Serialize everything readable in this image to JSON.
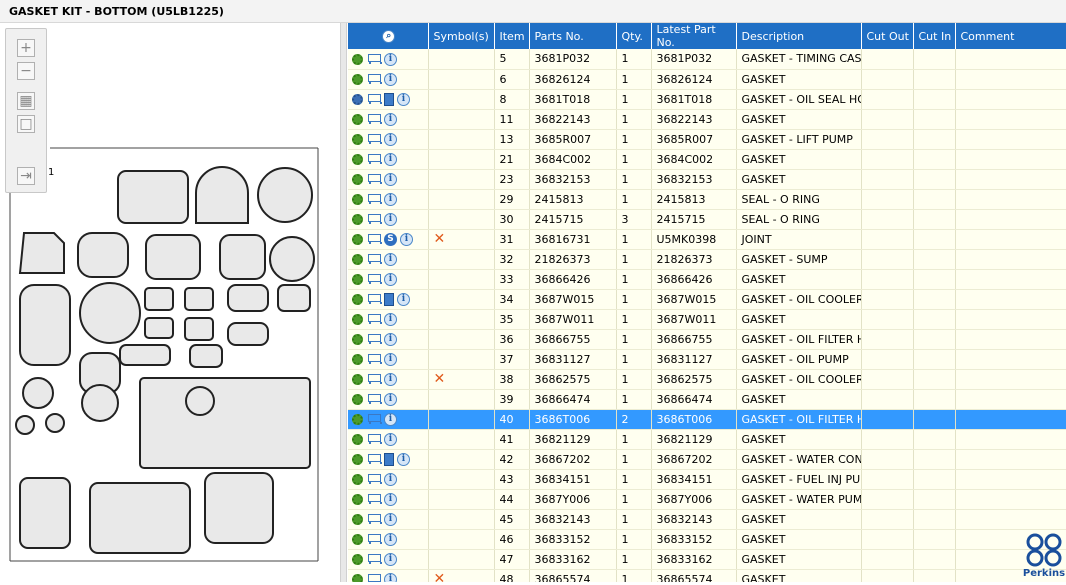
{
  "window": {
    "title": "GASKET KIT - BOTTOM (U5LB1225)"
  },
  "diagram": {
    "callout": "1"
  },
  "toolbox": {
    "zoom_in": "zoom-in-icon",
    "zoom_out": "zoom-out-icon",
    "fit": "fit-icon",
    "actual": "actual-size-icon",
    "export": "export-icon"
  },
  "columns": [
    "",
    "Symbol(s)",
    "Item",
    "Parts No.",
    "Qty.",
    "Latest Part No.",
    "Description",
    "Cut Out",
    "Cut In",
    "Comment"
  ],
  "rows": [
    {
      "icons": [
        "gear",
        "cart",
        "info"
      ],
      "symbol": "",
      "item": "5",
      "part": "3681P032",
      "qty": "1",
      "latest": "3681P032",
      "desc": "GASKET - TIMING CASE"
    },
    {
      "icons": [
        "gear",
        "cart",
        "info"
      ],
      "symbol": "",
      "item": "6",
      "part": "36826124",
      "qty": "1",
      "latest": "36826124",
      "desc": "GASKET"
    },
    {
      "icons": [
        "gear2",
        "cart",
        "book",
        "info"
      ],
      "symbol": "",
      "item": "8",
      "part": "3681T018",
      "qty": "1",
      "latest": "3681T018",
      "desc": "GASKET - OIL SEAL HOU"
    },
    {
      "icons": [
        "gear",
        "cart",
        "info"
      ],
      "symbol": "",
      "item": "11",
      "part": "36822143",
      "qty": "1",
      "latest": "36822143",
      "desc": "GASKET"
    },
    {
      "icons": [
        "gear",
        "cart",
        "info"
      ],
      "symbol": "",
      "item": "13",
      "part": "3685R007",
      "qty": "1",
      "latest": "3685R007",
      "desc": "GASKET - LIFT PUMP"
    },
    {
      "icons": [
        "gear",
        "cart",
        "info"
      ],
      "symbol": "",
      "item": "21",
      "part": "3684C002",
      "qty": "1",
      "latest": "3684C002",
      "desc": "GASKET"
    },
    {
      "icons": [
        "gear",
        "cart",
        "info"
      ],
      "symbol": "",
      "item": "23",
      "part": "36832153",
      "qty": "1",
      "latest": "36832153",
      "desc": "GASKET"
    },
    {
      "icons": [
        "gear",
        "cart",
        "info"
      ],
      "symbol": "",
      "item": "29",
      "part": "2415813",
      "qty": "1",
      "latest": "2415813",
      "desc": "SEAL - O RING"
    },
    {
      "icons": [
        "gear",
        "cart",
        "info"
      ],
      "symbol": "",
      "item": "30",
      "part": "2415715",
      "qty": "3",
      "latest": "2415715",
      "desc": "SEAL - O RING"
    },
    {
      "icons": [
        "gear",
        "cart",
        "scoin",
        "info"
      ],
      "symbol": "x",
      "item": "31",
      "part": "36816731",
      "qty": "1",
      "latest": "U5MK0398",
      "desc": "JOINT"
    },
    {
      "icons": [
        "gear",
        "cart",
        "info"
      ],
      "symbol": "",
      "item": "32",
      "part": "21826373",
      "qty": "1",
      "latest": "21826373",
      "desc": "GASKET - SUMP"
    },
    {
      "icons": [
        "gear",
        "cart",
        "info"
      ],
      "symbol": "",
      "item": "33",
      "part": "36866426",
      "qty": "1",
      "latest": "36866426",
      "desc": "GASKET"
    },
    {
      "icons": [
        "gear",
        "cart",
        "book",
        "info"
      ],
      "symbol": "",
      "item": "34",
      "part": "3687W015",
      "qty": "1",
      "latest": "3687W015",
      "desc": "GASKET - OIL COOLER"
    },
    {
      "icons": [
        "gear",
        "cart",
        "info"
      ],
      "symbol": "",
      "item": "35",
      "part": "3687W011",
      "qty": "1",
      "latest": "3687W011",
      "desc": "GASKET"
    },
    {
      "icons": [
        "gear",
        "cart",
        "info"
      ],
      "symbol": "",
      "item": "36",
      "part": "36866755",
      "qty": "1",
      "latest": "36866755",
      "desc": "GASKET - OIL FILTER HEA"
    },
    {
      "icons": [
        "gear",
        "cart",
        "info"
      ],
      "symbol": "",
      "item": "37",
      "part": "36831127",
      "qty": "1",
      "latest": "36831127",
      "desc": "GASKET - OIL PUMP"
    },
    {
      "icons": [
        "gear",
        "cart",
        "info"
      ],
      "symbol": "x",
      "item": "38",
      "part": "36862575",
      "qty": "1",
      "latest": "36862575",
      "desc": "GASKET - OIL COOLER"
    },
    {
      "icons": [
        "gear",
        "cart",
        "info"
      ],
      "symbol": "",
      "item": "39",
      "part": "36866474",
      "qty": "1",
      "latest": "36866474",
      "desc": "GASKET"
    },
    {
      "icons": [
        "gear",
        "cart",
        "info"
      ],
      "symbol": "",
      "item": "40",
      "part": "3686T006",
      "qty": "2",
      "latest": "3686T006",
      "desc": "GASKET - OIL FILTER HEA",
      "selected": true
    },
    {
      "icons": [
        "gear",
        "cart",
        "info"
      ],
      "symbol": "",
      "item": "41",
      "part": "36821129",
      "qty": "1",
      "latest": "36821129",
      "desc": "GASKET"
    },
    {
      "icons": [
        "gear",
        "cart",
        "book",
        "info"
      ],
      "symbol": "",
      "item": "42",
      "part": "36867202",
      "qty": "1",
      "latest": "36867202",
      "desc": "GASKET - WATER CONN"
    },
    {
      "icons": [
        "gear",
        "cart",
        "info"
      ],
      "symbol": "",
      "item": "43",
      "part": "36834151",
      "qty": "1",
      "latest": "36834151",
      "desc": "GASKET - FUEL INJ PUM"
    },
    {
      "icons": [
        "gear",
        "cart",
        "info"
      ],
      "symbol": "",
      "item": "44",
      "part": "3687Y006",
      "qty": "1",
      "latest": "3687Y006",
      "desc": "GASKET - WATER PUMP"
    },
    {
      "icons": [
        "gear",
        "cart",
        "info"
      ],
      "symbol": "",
      "item": "45",
      "part": "36832143",
      "qty": "1",
      "latest": "36832143",
      "desc": "GASKET"
    },
    {
      "icons": [
        "gear",
        "cart",
        "info"
      ],
      "symbol": "",
      "item": "46",
      "part": "36833152",
      "qty": "1",
      "latest": "36833152",
      "desc": "GASKET"
    },
    {
      "icons": [
        "gear",
        "cart",
        "info"
      ],
      "symbol": "",
      "item": "47",
      "part": "36833162",
      "qty": "1",
      "latest": "36833162",
      "desc": "GASKET"
    },
    {
      "icons": [
        "gear",
        "cart",
        "info"
      ],
      "symbol": "x",
      "item": "48",
      "part": "36865574",
      "qty": "1",
      "latest": "36865574",
      "desc": "GASKET"
    }
  ],
  "brand": {
    "name": "Perkins",
    "color": "#1a4f9c"
  },
  "colors": {
    "header": "#1f6fc5",
    "row_bg": "#fffff0",
    "selected": "#3399ff"
  }
}
